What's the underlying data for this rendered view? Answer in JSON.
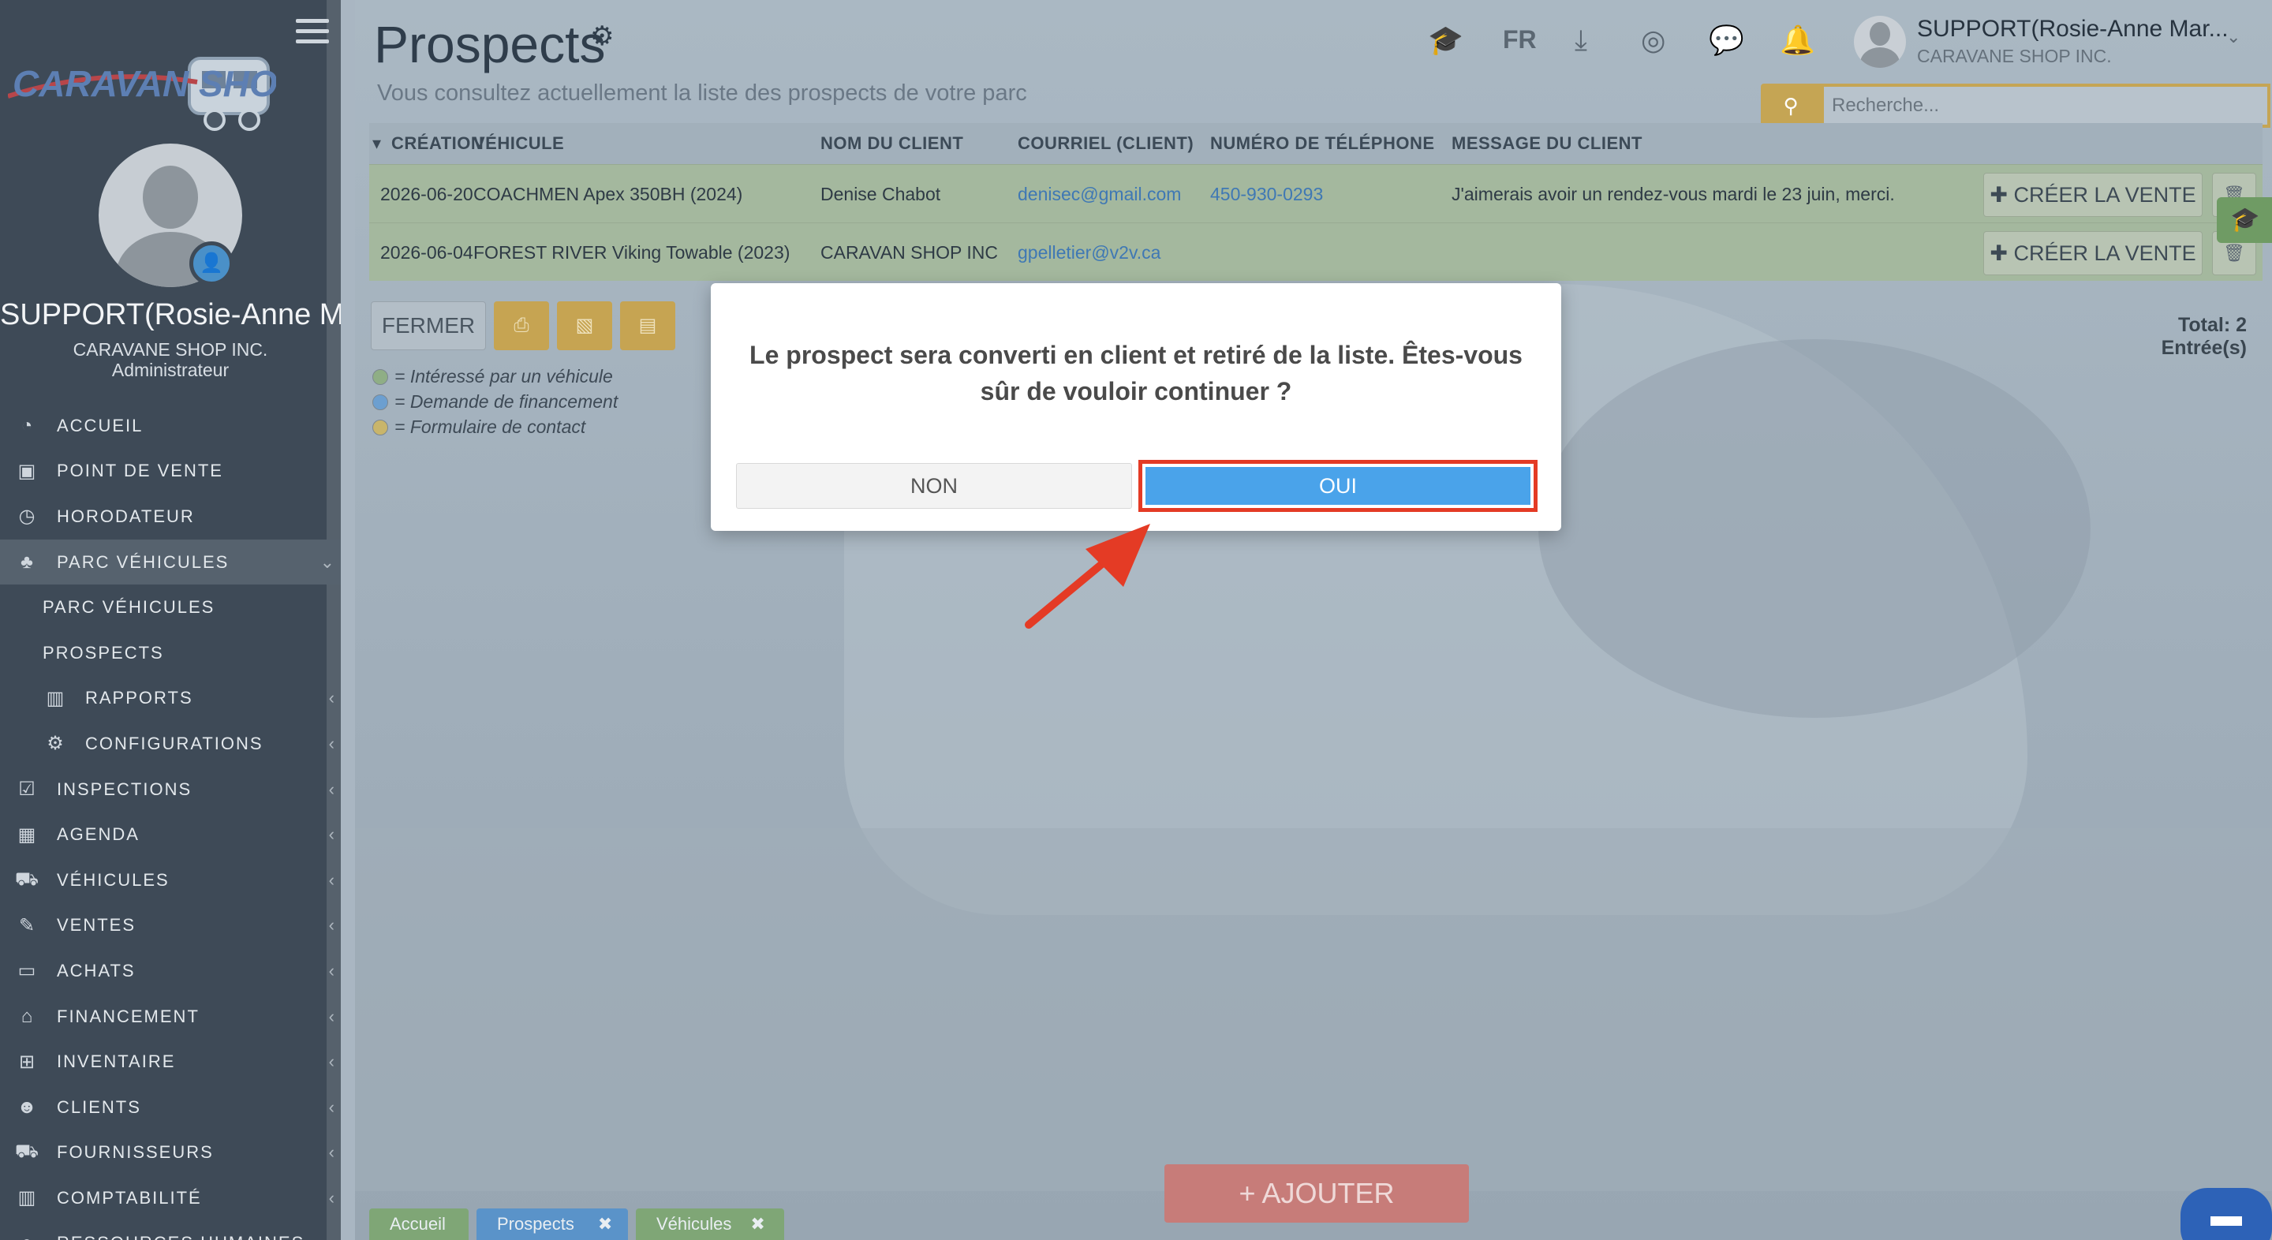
{
  "sidebar": {
    "logo_text": "CARAVAN SHOP",
    "user_name": "SUPPORT(Rosie-Anne M...",
    "company": "CARAVANE SHOP INC.",
    "role": "Administrateur",
    "items": [
      {
        "label": "ACCUEIL",
        "icon": "dashboard-icon",
        "glyph": "◔",
        "chevron": ""
      },
      {
        "label": "POINT DE VENTE",
        "icon": "cash-register-icon",
        "glyph": "▣",
        "chevron": ""
      },
      {
        "label": "HORODATEUR",
        "icon": "clock-icon",
        "glyph": "◷",
        "chevron": ""
      },
      {
        "label": "PARC VÉHICULES",
        "icon": "sitemap-icon",
        "glyph": "♣",
        "chevron": "⌄"
      },
      {
        "label": "PARC VÉHICULES",
        "icon": "",
        "glyph": "",
        "chevron": ""
      },
      {
        "label": "PROSPECTS",
        "icon": "",
        "glyph": "",
        "chevron": ""
      },
      {
        "label": "RAPPORTS",
        "icon": "bar-chart-icon",
        "glyph": "▥",
        "chevron": "‹"
      },
      {
        "label": "CONFIGURATIONS",
        "icon": "gear-icon",
        "glyph": "⚙",
        "chevron": "‹"
      },
      {
        "label": "INSPECTIONS",
        "icon": "checkbox-icon",
        "glyph": "☑",
        "chevron": "‹"
      },
      {
        "label": "AGENDA",
        "icon": "calendar-icon",
        "glyph": "▦",
        "chevron": "‹"
      },
      {
        "label": "VÉHICULES",
        "icon": "car-icon",
        "glyph": "⛟",
        "chevron": "‹"
      },
      {
        "label": "VENTES",
        "icon": "edit-icon",
        "glyph": "✎",
        "chevron": "‹"
      },
      {
        "label": "ACHATS",
        "icon": "credit-card-icon",
        "glyph": "▭",
        "chevron": "‹"
      },
      {
        "label": "FINANCEMENT",
        "icon": "bank-icon",
        "glyph": "⌂",
        "chevron": "‹"
      },
      {
        "label": "INVENTAIRE",
        "icon": "cart-icon",
        "glyph": "⊞",
        "chevron": "‹"
      },
      {
        "label": "CLIENTS",
        "icon": "users-icon",
        "glyph": "☻",
        "chevron": "‹"
      },
      {
        "label": "FOURNISSEURS",
        "icon": "truck-icon",
        "glyph": "⛟",
        "chevron": "‹"
      },
      {
        "label": "COMPTABILITÉ",
        "icon": "bar-chart-icon",
        "glyph": "▥",
        "chevron": "‹"
      },
      {
        "label": "RESSOURCES HUMAINES",
        "icon": "user-icon",
        "glyph": "●",
        "chevron": ""
      }
    ]
  },
  "header": {
    "title": "Prospects",
    "subtitle": "Vous consultez actuellement la liste des prospects de votre parc",
    "lang": "FR",
    "user_name": "SUPPORT(Rosie-Anne Mar...",
    "user_company": "CARAVANE SHOP INC.",
    "search_placeholder": "Recherche..."
  },
  "table": {
    "columns": [
      "CRÉATION",
      "VÉHICULE",
      "NOM DU CLIENT",
      "COURRIEL (CLIENT)",
      "NUMÉRO DE TÉLÉPHONE",
      "MESSAGE DU CLIENT"
    ],
    "rows": [
      {
        "date": "2026-06-20",
        "vehicle": "COACHMEN Apex 350BH (2024)",
        "client": "Denise Chabot",
        "email": "denisec@gmail.com",
        "phone": "450-930-0293",
        "message": "J'aimerais avoir un rendez-vous mardi le 23 juin, merci."
      },
      {
        "date": "2026-06-04",
        "vehicle": "FOREST RIVER Viking Towable (2023)",
        "client": "CARAVAN SHOP INC",
        "email": "gpelletier@v2v.ca",
        "phone": "",
        "message": ""
      }
    ],
    "create_label": "CRÉER LA VENTE",
    "total": "Total: 2 Entrée(s)"
  },
  "toolbar": {
    "close_label": "FERMER"
  },
  "legend": [
    {
      "text": "= Intéressé par un véhicule",
      "color": "#8fae85"
    },
    {
      "text": "= Demande de financement",
      "color": "#6c9fd0"
    },
    {
      "text": "= Formulaire de contact",
      "color": "#c9b56a"
    }
  ],
  "add_label": "AJOUTER",
  "bottom_tabs": [
    {
      "label": "Accueil",
      "color": "#7fa676",
      "closable": false
    },
    {
      "label": "Prospects",
      "color": "#5a93c9",
      "closable": true
    },
    {
      "label": "Véhicules",
      "color": "#7fa676",
      "closable": true
    }
  ],
  "dialog": {
    "message": "Le prospect sera converti en client et retiré de la liste. Êtes-vous sûr de vouloir continuer ?",
    "no_label": "NON",
    "yes_label": "OUI"
  },
  "colors": {
    "highlight": "#e43b25",
    "primary": "#4aa3ea",
    "gold": "#c5a554"
  }
}
